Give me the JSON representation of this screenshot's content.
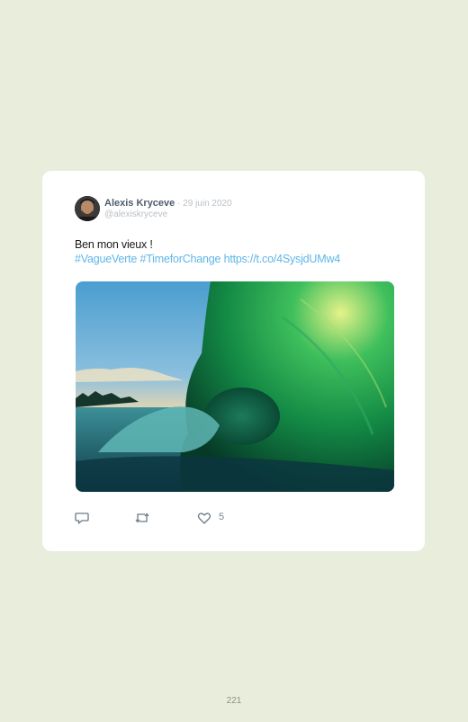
{
  "tweet": {
    "author_name": "Alexis Kryceve",
    "separator": " · ",
    "date": "29 juin 2020",
    "handle": "@alexiskryceve",
    "text": "Ben mon vieux  !",
    "hashtags": [
      "#VagueVerte",
      "#TimeforChange"
    ],
    "link": "https://t.co/4SysjdUMw4",
    "like_count": "5",
    "link_color": "#5fb6e6"
  },
  "icons": {
    "reply": "reply-icon",
    "retweet": "retweet-icon",
    "like": "heart-icon"
  },
  "page": {
    "number": "221"
  }
}
